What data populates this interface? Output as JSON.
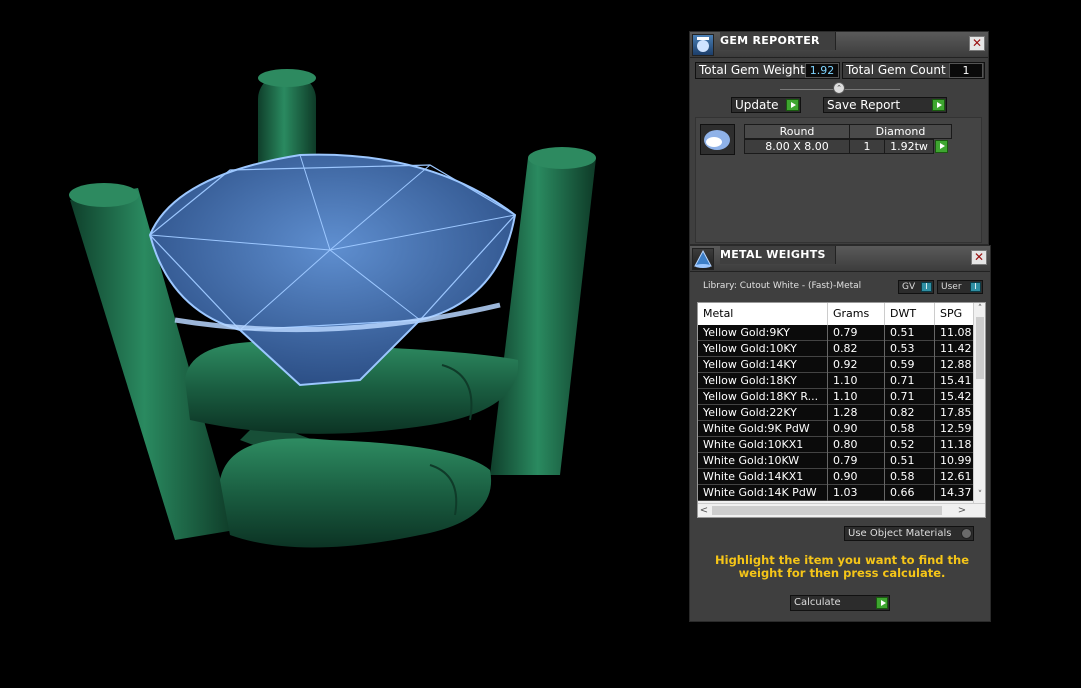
{
  "gem_reporter": {
    "title": "GEM REPORTER",
    "total_weight_label": "Total Gem Weight",
    "total_weight_value": "1.92",
    "total_count_label": "Total Gem Count",
    "total_count_value": "1",
    "update_label": "Update",
    "save_report_label": "Save Report",
    "gem": {
      "shape": "Round",
      "type": "Diamond",
      "size": "8.00 X 8.00",
      "qty": "1",
      "weight": "1.92tw"
    }
  },
  "metal_weights": {
    "title": "METAL WEIGHTS",
    "library_label": "Library: Cutout White - (Fast)-Metal",
    "gv_toggle_label": "GV",
    "user_toggle_label": "User",
    "toggle_glyph": "I",
    "columns": [
      "Metal",
      "Grams",
      "DWT",
      "SPG"
    ],
    "rows": [
      {
        "metal": "Yellow Gold:9KY",
        "grams": "0.79",
        "dwt": "0.51",
        "spg": "11.08"
      },
      {
        "metal": "Yellow Gold:10KY",
        "grams": "0.82",
        "dwt": "0.53",
        "spg": "11.42"
      },
      {
        "metal": "Yellow Gold:14KY",
        "grams": "0.92",
        "dwt": "0.59",
        "spg": "12.88"
      },
      {
        "metal": "Yellow Gold:18KY",
        "grams": "1.10",
        "dwt": "0.71",
        "spg": "15.41"
      },
      {
        "metal": "Yellow Gold:18KY R...",
        "grams": "1.10",
        "dwt": "0.71",
        "spg": "15.42"
      },
      {
        "metal": "Yellow Gold:22KY",
        "grams": "1.28",
        "dwt": "0.82",
        "spg": "17.85"
      },
      {
        "metal": "White Gold:9K PdW",
        "grams": "0.90",
        "dwt": "0.58",
        "spg": "12.59"
      },
      {
        "metal": "White Gold:10KX1",
        "grams": "0.80",
        "dwt": "0.52",
        "spg": "11.18"
      },
      {
        "metal": "White Gold:10KW",
        "grams": "0.79",
        "dwt": "0.51",
        "spg": "10.99"
      },
      {
        "metal": "White Gold:14KX1",
        "grams": "0.90",
        "dwt": "0.58",
        "spg": "12.61"
      },
      {
        "metal": "White Gold:14K PdW",
        "grams": "1.03",
        "dwt": "0.66",
        "spg": "14.37"
      }
    ],
    "use_object_materials_label": "Use Object Materials",
    "hint": "Highlight the item you want to find the weight for then press calculate.",
    "calculate_label": "Calculate"
  },
  "icons": {
    "close": "close-icon",
    "panel_arrow": "play-arrow-icon",
    "scroll_up": "˄",
    "scroll_down": "˅",
    "scroll_left": "<",
    "scroll_right": ">",
    "close_glyph": "✕",
    "slider_glyph": "⌃"
  },
  "colors": {
    "viewport_bg": "#000000",
    "metal_green": "#1f6b4a",
    "gem_blue": "#4a7fc0",
    "gem_wire": "#9cc7ff",
    "hint_yellow": "#f5c518",
    "value_cyan": "#7fd4ff"
  }
}
